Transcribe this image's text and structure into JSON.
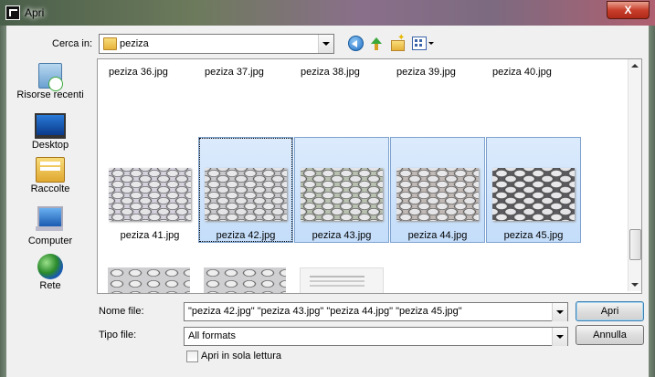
{
  "window": {
    "title": "Apri",
    "close_label": "X"
  },
  "toolbar": {
    "lookin_label": "Cerca in:",
    "lookin_value": "peziza",
    "icons": [
      "back-icon",
      "up-folder-icon",
      "new-folder-icon",
      "view-menu-icon"
    ]
  },
  "sidebar": {
    "items": [
      {
        "label": "Risorse recenti",
        "icon": "recent-places-icon"
      },
      {
        "label": "Desktop",
        "icon": "desktop-icon"
      },
      {
        "label": "Raccolte",
        "icon": "libraries-icon"
      },
      {
        "label": "Computer",
        "icon": "computer-icon"
      },
      {
        "label": "Rete",
        "icon": "network-icon"
      }
    ]
  },
  "files": {
    "top_row": [
      "peziza 36.jpg",
      "peziza 37.jpg",
      "peziza 38.jpg",
      "peziza 39.jpg",
      "peziza 40.jpg"
    ],
    "middle_row": [
      {
        "name": "peziza 41.jpg",
        "selected": false
      },
      {
        "name": "peziza 42.jpg",
        "selected": true
      },
      {
        "name": "peziza 43.jpg",
        "selected": true
      },
      {
        "name": "peziza 44.jpg",
        "selected": true
      },
      {
        "name": "peziza 45.jpg",
        "selected": true
      }
    ]
  },
  "bottom": {
    "filename_label": "Nome file:",
    "filename_value": "\"peziza 42.jpg\" \"peziza 43.jpg\" \"peziza 44.jpg\" \"peziza 45.jpg\"",
    "filetype_label": "Tipo file:",
    "filetype_value": "All formats",
    "readonly_label": "Apri in sola lettura",
    "readonly_checked": false,
    "open_button": "Apri",
    "cancel_button": "Annulla"
  },
  "colors": {
    "selection": "#cce0f8",
    "selection_border": "#7da2ce",
    "close": "#c8402c"
  }
}
